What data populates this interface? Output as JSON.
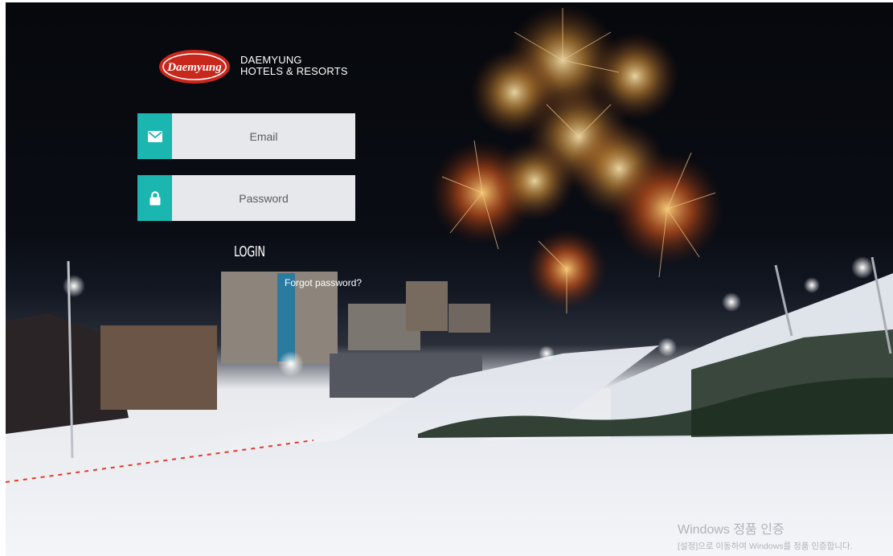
{
  "brand": {
    "logo_word": "Daemyung",
    "line1": "DAEMYUNG",
    "line2": "HOTELS & RESORTS"
  },
  "login_form": {
    "email_placeholder": "Email",
    "password_placeholder": "Password",
    "email_icon": "envelope-icon",
    "password_icon": "lock-icon",
    "login_label": "LOGIN",
    "forgot_label": "Forgot password?"
  },
  "colors": {
    "accent": "#1bb6b0",
    "field_bg": "#e6e8ec",
    "logo_red": "#c8281c"
  },
  "windows_watermark": {
    "line1": "Windows 정품 인증",
    "line2": "[설정]으로 이동하여 Windows를 정품 인증합니다."
  }
}
